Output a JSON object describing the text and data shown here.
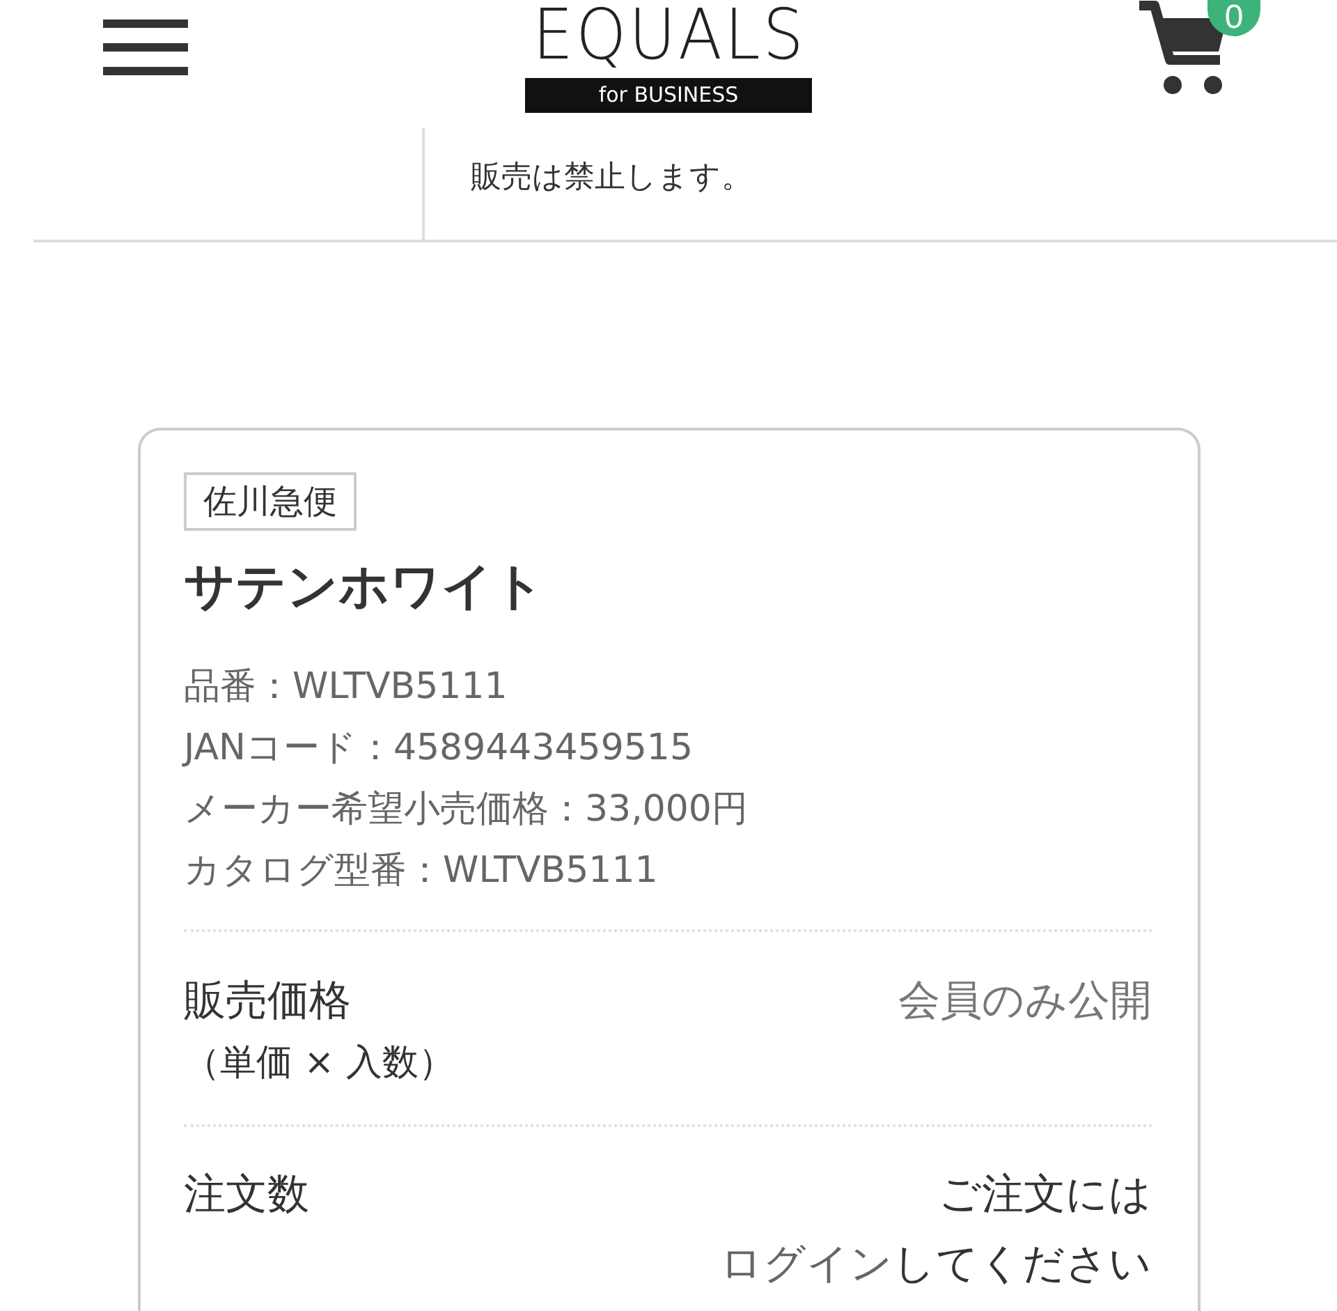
{
  "header": {
    "logo": {
      "title": "EQUALS",
      "subtitle": "for BUSINESS"
    },
    "cart": {
      "count": "0"
    }
  },
  "notice": {
    "text": "販売は禁止します。"
  },
  "product": {
    "shipping_tag": "佐川急便",
    "name": "サテンホワイト",
    "specs": [
      "品番：WLTVB5111",
      "JANコード：4589443459515",
      "メーカー希望小売価格：33,000円",
      "カタログ型番：WLTVB5111"
    ],
    "price": {
      "label": "販売価格",
      "sublabel": "（単価 × 入数）",
      "value": "会員のみ公開"
    },
    "order": {
      "label": "注文数",
      "note": {
        "before": "ご注文には",
        "link": "ログイン",
        "after": "してください"
      }
    }
  }
}
